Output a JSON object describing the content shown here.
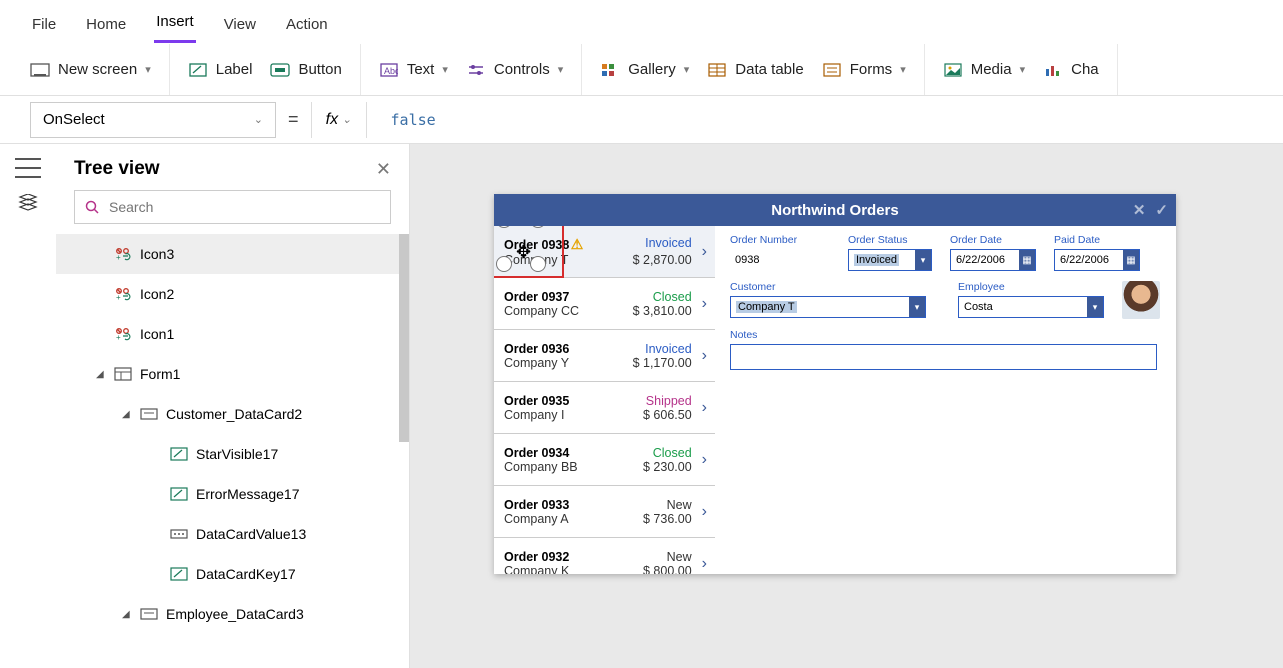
{
  "menu": {
    "file": "File",
    "home": "Home",
    "insert": "Insert",
    "view": "View",
    "action": "Action"
  },
  "ribbon": {
    "newscreen": "New screen",
    "label": "Label",
    "button": "Button",
    "text": "Text",
    "controls": "Controls",
    "gallery": "Gallery",
    "datatable": "Data table",
    "forms": "Forms",
    "media": "Media",
    "chart": "Cha"
  },
  "fx": {
    "property": "OnSelect",
    "formula": "false",
    "fxlabel": "fx"
  },
  "panel": {
    "title": "Tree view",
    "search_ph": "Search"
  },
  "tree": [
    {
      "depth": 1,
      "label": "Icon3",
      "ico": "icon",
      "sel": true
    },
    {
      "depth": 1,
      "label": "Icon2",
      "ico": "icon"
    },
    {
      "depth": 1,
      "label": "Icon1",
      "ico": "icon"
    },
    {
      "depth": 1,
      "label": "Form1",
      "ico": "form",
      "exp": true
    },
    {
      "depth": 2,
      "label": "Customer_DataCard2",
      "ico": "card",
      "exp": true
    },
    {
      "depth": 3,
      "label": "StarVisible17",
      "ico": "lbl"
    },
    {
      "depth": 3,
      "label": "ErrorMessage17",
      "ico": "lbl"
    },
    {
      "depth": 3,
      "label": "DataCardValue13",
      "ico": "input"
    },
    {
      "depth": 3,
      "label": "DataCardKey17",
      "ico": "lbl"
    },
    {
      "depth": 2,
      "label": "Employee_DataCard3",
      "ico": "card",
      "exp": true
    }
  ],
  "app": {
    "title": "Northwind Orders",
    "orders": [
      {
        "no": "Order 0938",
        "cust": "Company T",
        "status": "Invoiced",
        "amt": "$ 2,870.00",
        "sel": true,
        "warn": true
      },
      {
        "no": "Order 0937",
        "cust": "Company CC",
        "status": "Closed",
        "amt": "$ 3,810.00"
      },
      {
        "no": "Order 0936",
        "cust": "Company Y",
        "status": "Invoiced",
        "amt": "$ 1,170.00"
      },
      {
        "no": "Order 0935",
        "cust": "Company I",
        "status": "Shipped",
        "amt": "$ 606.50"
      },
      {
        "no": "Order 0934",
        "cust": "Company BB",
        "status": "Closed",
        "amt": "$ 230.00"
      },
      {
        "no": "Order 0933",
        "cust": "Company A",
        "status": "New",
        "amt": "$ 736.00"
      },
      {
        "no": "Order 0932",
        "cust": "Company K",
        "status": "New",
        "amt": "$ 800.00"
      }
    ],
    "form": {
      "ordernum_lbl": "Order Number",
      "ordernum": "0938",
      "status_lbl": "Order Status",
      "status": "Invoiced",
      "orderdate_lbl": "Order Date",
      "orderdate": "6/22/2006",
      "paiddate_lbl": "Paid Date",
      "paiddate": "6/22/2006",
      "customer_lbl": "Customer",
      "customer": "Company T",
      "employee_lbl": "Employee",
      "employee": "Costa",
      "notes_lbl": "Notes"
    }
  }
}
